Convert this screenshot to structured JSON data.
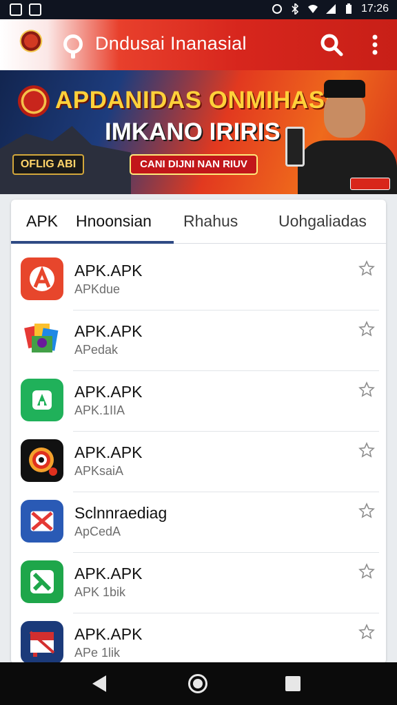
{
  "status_bar": {
    "time": "17:26"
  },
  "app_bar": {
    "title": "Dndusai Inanasial"
  },
  "banner": {
    "headline1": "APDANIDAS ONMIHASIA",
    "headline2": "IMKANO IRIRIS",
    "badge_left": "OFLIG ABI",
    "cta": "CANI DIJNI NAN RIUV"
  },
  "tabs": [
    {
      "label": "APK"
    },
    {
      "label": "Hnoonsian"
    },
    {
      "label": "Rhahus"
    },
    {
      "label": "Uohgaliadas"
    }
  ],
  "apps": [
    {
      "name": "APK.APK",
      "sub": "APKdue",
      "icon": "red-a-icon",
      "color": "#e7462c"
    },
    {
      "name": "APK.APK",
      "sub": "APedak",
      "icon": "colorful-cube-icon",
      "color": "#2a74d5"
    },
    {
      "name": "APK.APK",
      "sub": "APK.1IIA",
      "icon": "green-android-icon",
      "color": "#20b15a"
    },
    {
      "name": "APK.APK",
      "sub": "APKsaiA",
      "icon": "camera-lens-icon",
      "color": "#111111"
    },
    {
      "name": "Sclnnraediag",
      "sub": "ApCedA",
      "icon": "blue-x-icon",
      "color": "#2a5ab5"
    },
    {
      "name": "APK.APK",
      "sub": "APK 1bik",
      "icon": "green-check-icon",
      "color": "#1ea64a"
    },
    {
      "name": "APK.APK",
      "sub": "APe 1lik",
      "icon": "red-flag-icon",
      "color": "#1b3a7a"
    }
  ]
}
